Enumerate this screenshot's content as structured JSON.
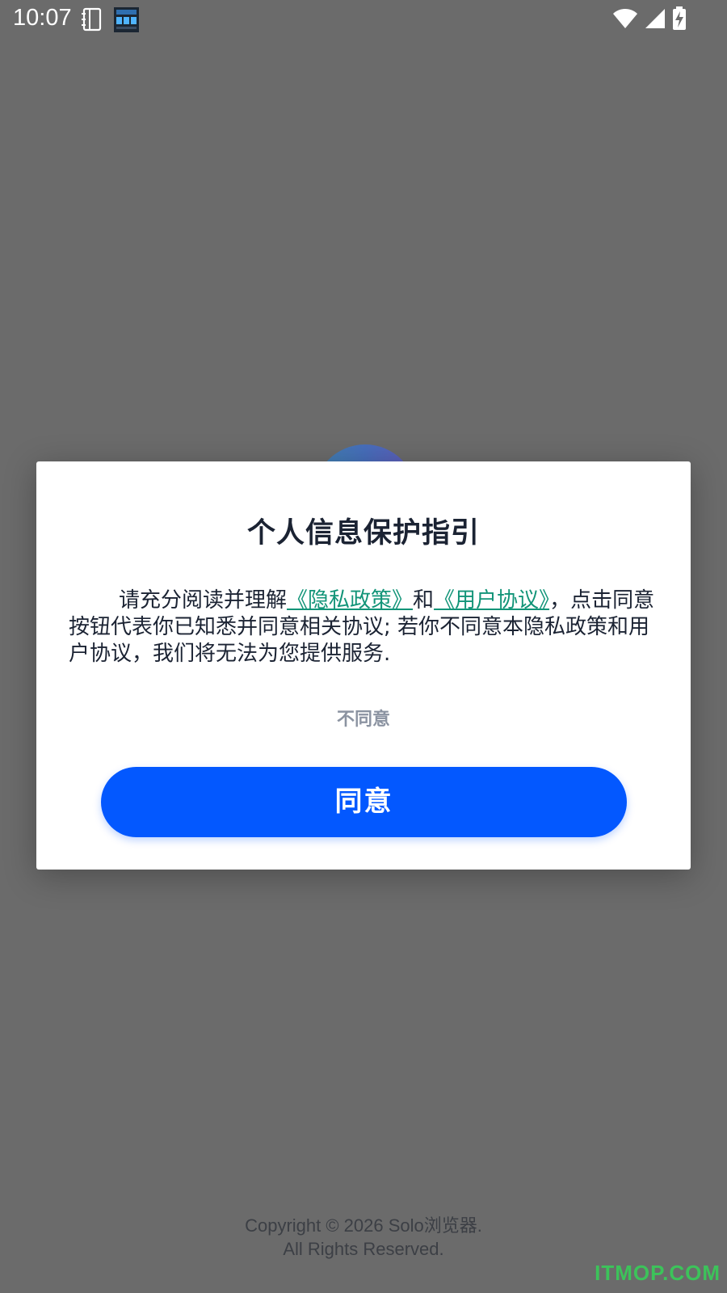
{
  "status_bar": {
    "time": "10:07",
    "icons": [
      "notebook-icon",
      "clock-widget-icon",
      "wifi-icon",
      "cell-signal-icon",
      "battery-charging-icon"
    ]
  },
  "dialog": {
    "title": "个人信息保护指引",
    "body": {
      "prefix": "请充分阅读并理解",
      "privacy_link": "《隐私政策》",
      "conjunction": "和",
      "agreement_link": "《用户协议》",
      "suffix": "，点击同意按钮代表你已知悉并同意相关协议; 若你不同意本隐私政策和用户协议，我们将无法为您提供服务."
    },
    "disagree_label": "不同意",
    "agree_label": "同意"
  },
  "footer": {
    "line1": "Copyright © 2026 Solo浏览器.",
    "line2": "All Rights Reserved."
  },
  "watermark": "ITMOP.COM",
  "colors": {
    "overlay": "#6b6b6b",
    "primary": "#0358ff",
    "link": "#129478",
    "title": "#1b2333",
    "muted": "#8b93a1"
  }
}
